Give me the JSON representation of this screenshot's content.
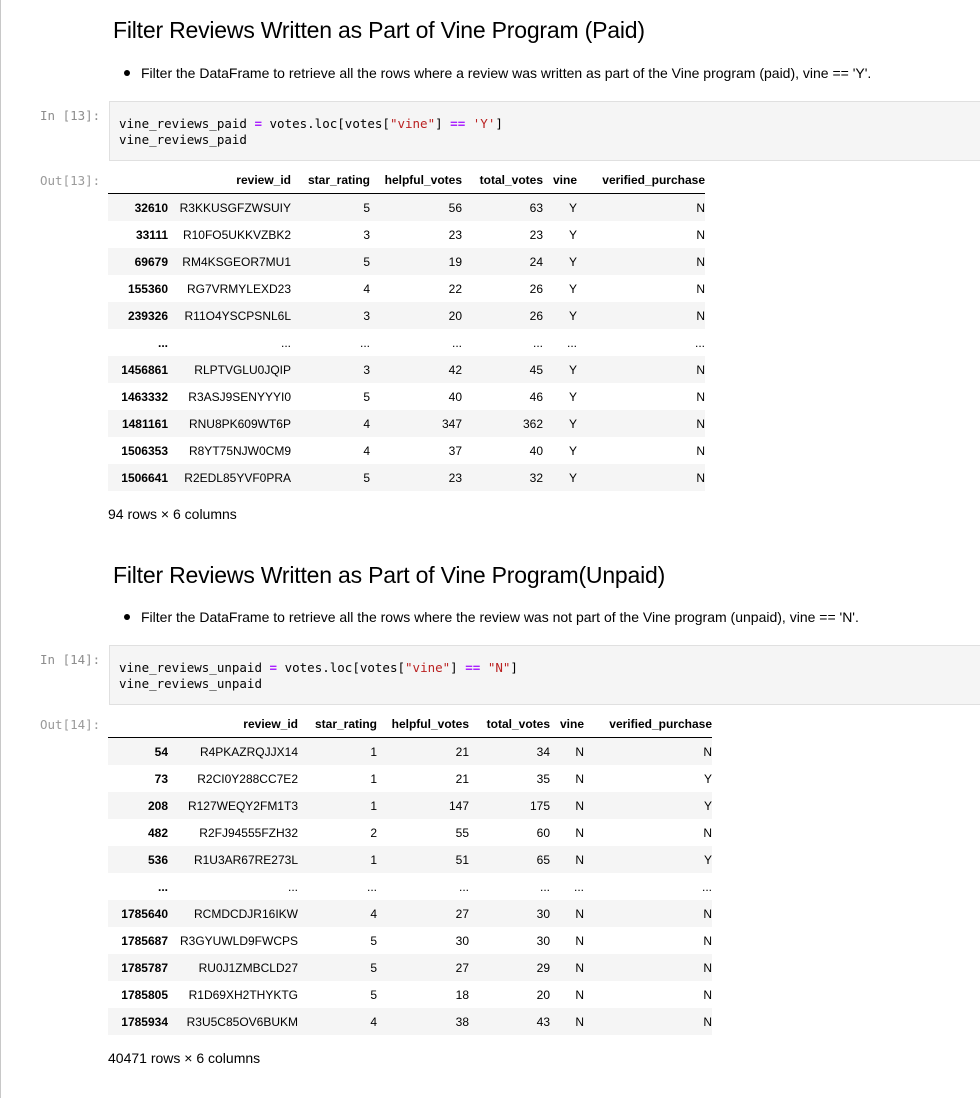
{
  "section1": {
    "heading": "Filter Reviews Written as Part of Vine Program (Paid)",
    "bullet": "Filter the DataFrame to retrieve all the rows where a review was written as part of the Vine program (paid), vine == 'Y'.",
    "prompt_in": "In [13]:",
    "prompt_out": "Out[13]:",
    "code": {
      "l1_var": "vine_reviews_paid",
      "l1_eq": "=",
      "l1_mid": "votes.loc[votes[",
      "l1_key": "\"vine\"",
      "l1_close": "]",
      "l1_op": "==",
      "l1_val": "'Y'",
      "l1_end": "]",
      "l2": "vine_reviews_paid"
    },
    "columns": [
      "",
      "review_id",
      "star_rating",
      "helpful_votes",
      "total_votes",
      "vine",
      "verified_purchase"
    ],
    "rows": [
      [
        "32610",
        "R3KKUSGFZWSUIY",
        "5",
        "56",
        "63",
        "Y",
        "N"
      ],
      [
        "33111",
        "R10FO5UKKVZBK2",
        "3",
        "23",
        "23",
        "Y",
        "N"
      ],
      [
        "69679",
        "RM4KSGEOR7MU1",
        "5",
        "19",
        "24",
        "Y",
        "N"
      ],
      [
        "155360",
        "RG7VRMYLEXD23",
        "4",
        "22",
        "26",
        "Y",
        "N"
      ],
      [
        "239326",
        "R11O4YSCPSNL6L",
        "3",
        "20",
        "26",
        "Y",
        "N"
      ],
      [
        "...",
        "...",
        "...",
        "...",
        "...",
        "...",
        "..."
      ],
      [
        "1456861",
        "RLPTVGLU0JQIP",
        "3",
        "42",
        "45",
        "Y",
        "N"
      ],
      [
        "1463332",
        "R3ASJ9SENYYYI0",
        "5",
        "40",
        "46",
        "Y",
        "N"
      ],
      [
        "1481161",
        "RNU8PK609WT6P",
        "4",
        "347",
        "362",
        "Y",
        "N"
      ],
      [
        "1506353",
        "R8YT75NJW0CM9",
        "4",
        "37",
        "40",
        "Y",
        "N"
      ],
      [
        "1506641",
        "R2EDL85YVF0PRA",
        "5",
        "23",
        "32",
        "Y",
        "N"
      ]
    ],
    "shape": "94 rows × 6 columns"
  },
  "section2": {
    "heading": "Filter Reviews Written as Part of Vine Program(Unpaid)",
    "bullet": "Filter the DataFrame to retrieve all the rows where the review was not part of the Vine program (unpaid), vine == 'N'.",
    "prompt_in": "In [14]:",
    "prompt_out": "Out[14]:",
    "code": {
      "l1_var": "vine_reviews_unpaid",
      "l1_eq": "=",
      "l1_mid": "votes.loc[votes[",
      "l1_key": "\"vine\"",
      "l1_close": "]",
      "l1_op": "==",
      "l1_val": "\"N\"",
      "l1_end": "]",
      "l2": "vine_reviews_unpaid"
    },
    "columns": [
      "",
      "review_id",
      "star_rating",
      "helpful_votes",
      "total_votes",
      "vine",
      "verified_purchase"
    ],
    "rows": [
      [
        "54",
        "R4PKAZRQJJX14",
        "1",
        "21",
        "34",
        "N",
        "N"
      ],
      [
        "73",
        "R2CI0Y288CC7E2",
        "1",
        "21",
        "35",
        "N",
        "Y"
      ],
      [
        "208",
        "R127WEQY2FM1T3",
        "1",
        "147",
        "175",
        "N",
        "Y"
      ],
      [
        "482",
        "R2FJ94555FZH32",
        "2",
        "55",
        "60",
        "N",
        "N"
      ],
      [
        "536",
        "R1U3AR67RE273L",
        "1",
        "51",
        "65",
        "N",
        "Y"
      ],
      [
        "...",
        "...",
        "...",
        "...",
        "...",
        "...",
        "..."
      ],
      [
        "1785640",
        "RCMDCDJR16IKW",
        "4",
        "27",
        "30",
        "N",
        "N"
      ],
      [
        "1785687",
        "R3GYUWLD9FWCPS",
        "5",
        "30",
        "30",
        "N",
        "N"
      ],
      [
        "1785787",
        "RU0J1ZMBCLD27",
        "5",
        "27",
        "29",
        "N",
        "N"
      ],
      [
        "1785805",
        "R1D69XH2THYKTG",
        "5",
        "18",
        "20",
        "N",
        "N"
      ],
      [
        "1785934",
        "R3U5C85OV6BUKM",
        "4",
        "38",
        "43",
        "N",
        "N"
      ]
    ],
    "shape": "40471 rows × 6 columns"
  }
}
